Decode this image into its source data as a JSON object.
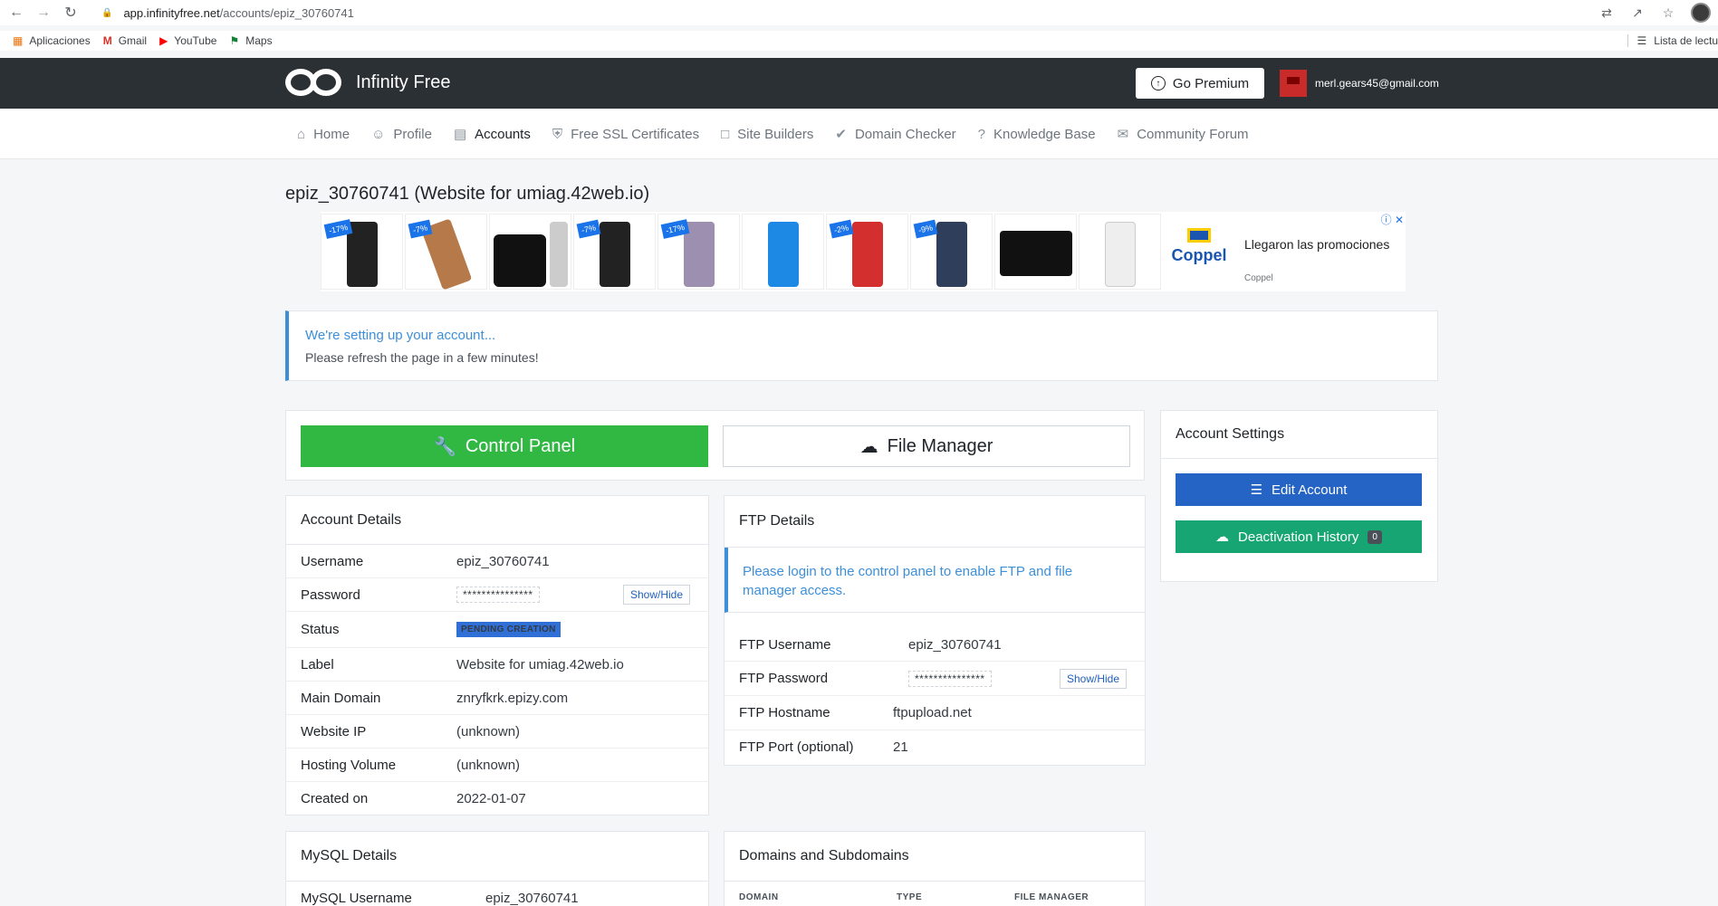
{
  "browser": {
    "url_host": "app.infinityfree.net",
    "url_path": "/accounts/epiz_30760741",
    "bookmarks": [
      "Aplicaciones",
      "Gmail",
      "YouTube",
      "Maps"
    ],
    "reading_list": "Lista de lectu"
  },
  "header": {
    "logo_text": "Infinity Free",
    "premium_label": "Go Premium",
    "user_email": "merl.gears45@gmail.com"
  },
  "nav": {
    "items": [
      {
        "label": "Home",
        "icon": "home-icon"
      },
      {
        "label": "Profile",
        "icon": "user-icon"
      },
      {
        "label": "Accounts",
        "icon": "accounts-icon"
      },
      {
        "label": "Free SSL Certificates",
        "icon": "shield-icon"
      },
      {
        "label": "Site Builders",
        "icon": "paint-roller-icon"
      },
      {
        "label": "Domain Checker",
        "icon": "check-circle-icon"
      },
      {
        "label": "Knowledge Base",
        "icon": "help-circle-icon"
      },
      {
        "label": "Community Forum",
        "icon": "forum-icon"
      }
    ],
    "active": "Accounts"
  },
  "page": {
    "title": "epiz_30760741 (Website for umiag.42web.io)"
  },
  "ad": {
    "tags": [
      "-17%",
      "-7%",
      "",
      "-7%",
      "-17%",
      "",
      "-2%",
      "-9%",
      "",
      ""
    ],
    "brand": "Coppel",
    "headline": "Llegaron las promociones",
    "source": "Coppel"
  },
  "alert": {
    "title": "We're setting up your account...",
    "text": "Please refresh the page in a few minutes!"
  },
  "actions": {
    "control_panel": "Control Panel",
    "file_manager": "File Manager"
  },
  "account_details": {
    "title": "Account Details",
    "username_label": "Username",
    "username": "epiz_30760741",
    "password_label": "Password",
    "password_mask": "***************",
    "status_label": "Status",
    "status": "PENDING CREATION",
    "label_label": "Label",
    "label": "Website for umiag.42web.io",
    "domain_label": "Main Domain",
    "domain": "znryfkrk.epizy.com",
    "ip_label": "Website IP",
    "ip": "(unknown)",
    "volume_label": "Hosting Volume",
    "volume": "(unknown)",
    "created_label": "Created on",
    "created": "2022-01-07",
    "show_hide": "Show/Hide"
  },
  "ftp": {
    "title": "FTP Details",
    "note": "Please login to the control panel to enable FTP and file manager access.",
    "username_label": "FTP Username",
    "username": "epiz_30760741",
    "password_label": "FTP Password",
    "password_mask": "***************",
    "host_label": "FTP Hostname",
    "host": "ftpupload.net",
    "port_label": "FTP Port (optional)",
    "port": "21",
    "show_hide": "Show/Hide"
  },
  "settings": {
    "title": "Account Settings",
    "edit": "Edit Account",
    "history": "Deactivation History",
    "history_count": "0",
    "edit_color": "#2563c4",
    "history_color": "#17a673"
  },
  "mysql": {
    "title": "MySQL Details",
    "username_label": "MySQL Username",
    "username": "epiz_30760741"
  },
  "domains": {
    "title": "Domains and Subdomains",
    "columns": [
      "DOMAIN",
      "TYPE",
      "FILE MANAGER"
    ]
  }
}
